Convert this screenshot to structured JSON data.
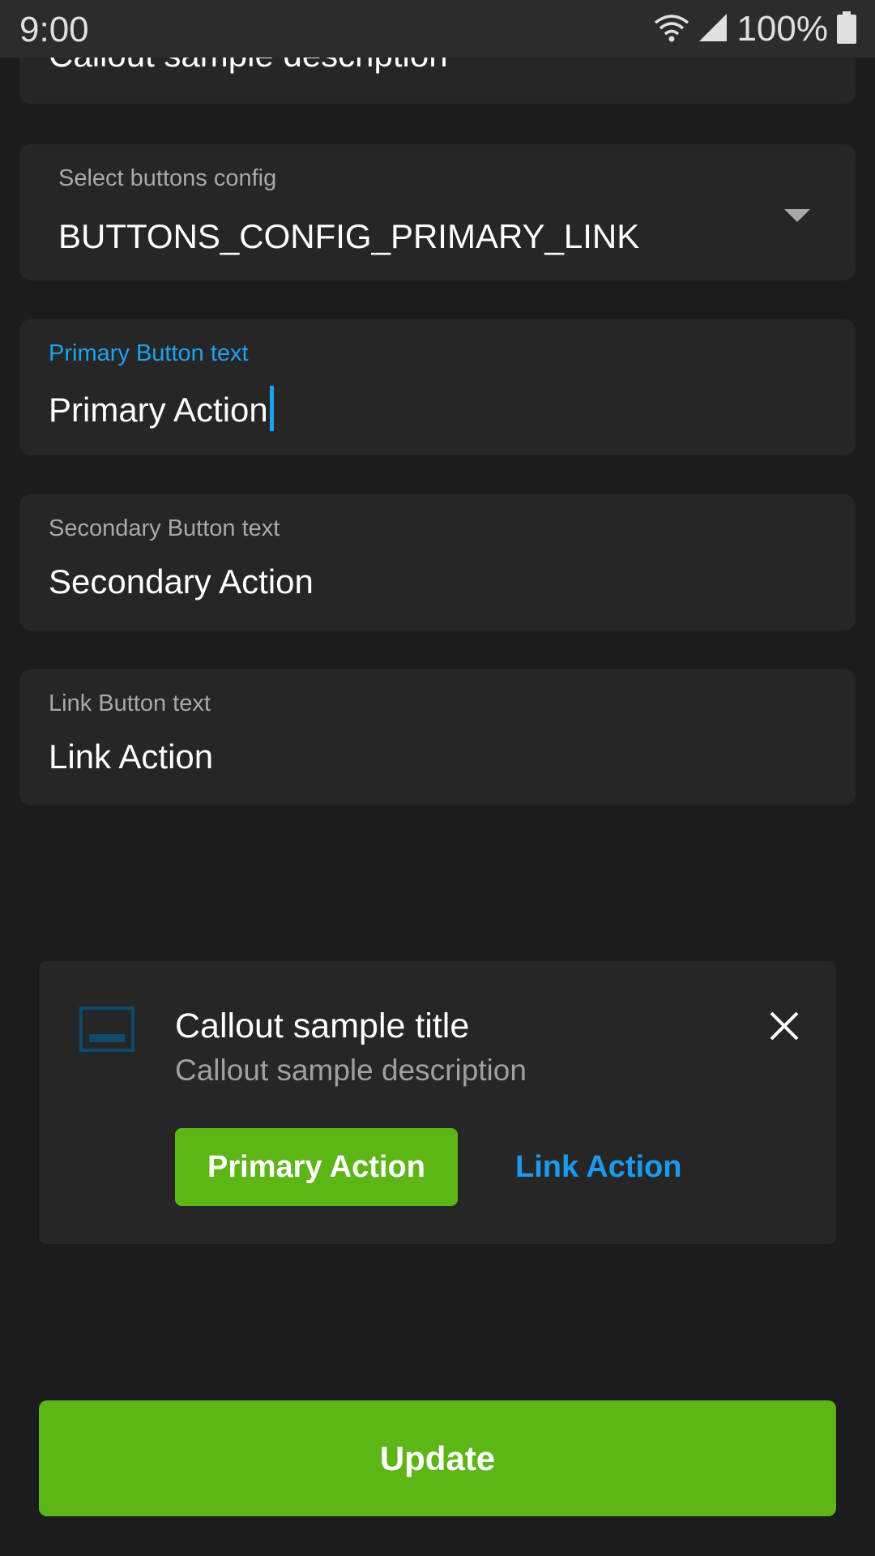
{
  "status_bar": {
    "time": "9:00",
    "battery": "100%"
  },
  "form": {
    "description_field": {
      "value": "Callout sample description"
    },
    "buttons_config": {
      "label": "Select buttons config",
      "value": "BUTTONS_CONFIG_PRIMARY_LINK"
    },
    "primary_button_text": {
      "label": "Primary Button text",
      "value": "Primary Action"
    },
    "secondary_button_text": {
      "label": "Secondary Button text",
      "value": "Secondary Action"
    },
    "link_button_text": {
      "label": "Link Button text",
      "value": "Link Action"
    }
  },
  "callout": {
    "title": "Callout sample title",
    "description": "Callout sample description",
    "primary_label": "Primary Action",
    "link_label": "Link Action",
    "icon": "image-icon",
    "close_icon": "close-icon"
  },
  "update_label": "Update",
  "colors": {
    "accent_green": "#5db517",
    "accent_blue": "#1da1f2",
    "background": "#1c1c1c",
    "surface": "#262626"
  }
}
